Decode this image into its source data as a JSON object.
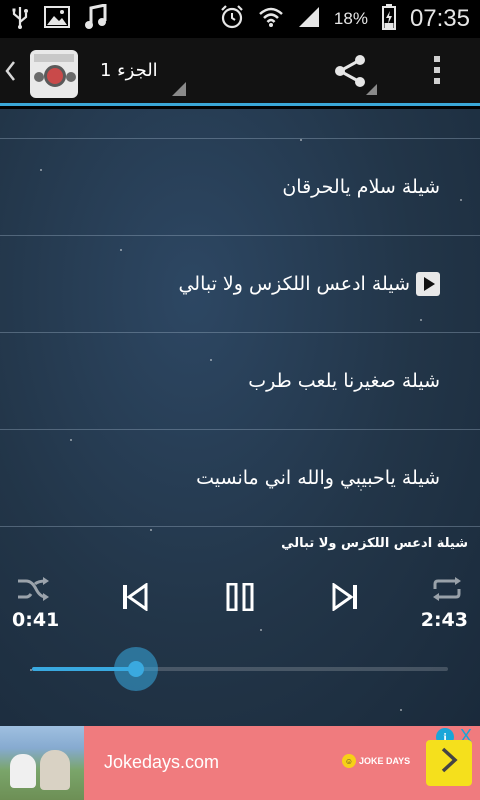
{
  "status_bar": {
    "icons": [
      "usb-icon",
      "image-icon",
      "music-icon",
      "alarm-icon",
      "wifi-icon",
      "signal-icon",
      "battery-icon"
    ],
    "battery": "18%",
    "time": "07:35"
  },
  "action_bar": {
    "title": "الجزء 1",
    "icons": [
      "back-chevron-icon",
      "app-logo-icon",
      "share-icon",
      "overflow-menu-icon"
    ]
  },
  "tracks": [
    {
      "label": "شيلة سلام يالحرقان",
      "playing": false
    },
    {
      "label": "شيلة ادعس اللكزس ولا تبالي",
      "playing": true
    },
    {
      "label": "شيلة صغيرنا يلعب طرب",
      "playing": false
    },
    {
      "label": "شيلة ياحبيبي والله اني مانسيت",
      "playing": false
    }
  ],
  "player": {
    "now_playing": "شيلة ادعس اللكزس ولا تبالي",
    "current_time": "0:41",
    "total_time": "2:43",
    "progress_fraction": 0.25,
    "controls": [
      "shuffle-icon",
      "previous-icon",
      "pause-icon",
      "next-icon",
      "repeat-icon"
    ]
  },
  "ad": {
    "text": "Jokedays.com",
    "badge": "JOKE DAYS",
    "info_label": "i",
    "close_label": "X",
    "cta_icon": "chevron-right-icon",
    "background_color": "#f07b7e",
    "cta_color": "#f5e01c"
  },
  "colors": {
    "accent": "#3aa7d8",
    "action_bar": "#121212"
  }
}
